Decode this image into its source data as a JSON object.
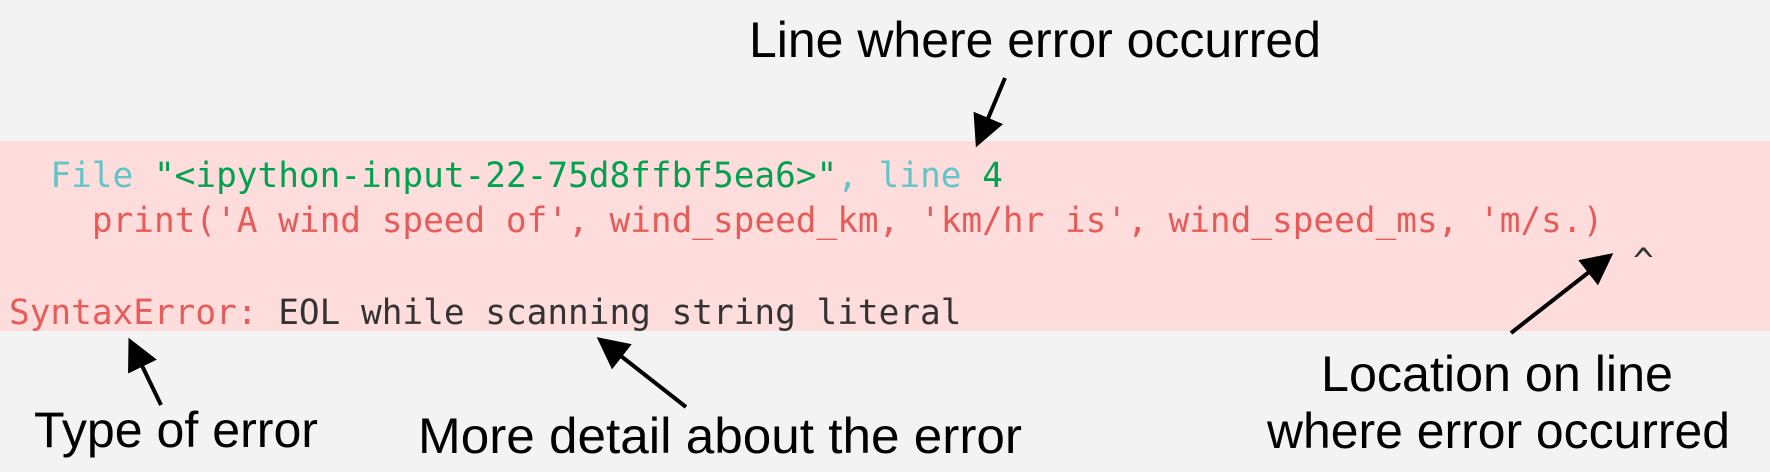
{
  "colors": {
    "background": "#f3f3f3",
    "error_band": "#ffdddd",
    "keyword": "#60c6c8",
    "string": "#00a250",
    "error": "#e75c58",
    "text": "#333333"
  },
  "traceback": {
    "file_keyword": "File",
    "file_name": "\"<ipython-input-22-75d8ffbf5ea6>\"",
    "comma": ",",
    "line_keyword": "line",
    "line_number": "4",
    "code_line": "print('A wind speed of', wind_speed_km, 'km/hr is', wind_speed_ms, 'm/s.)",
    "caret": "^",
    "error_type": "SyntaxError:",
    "error_message": "EOL while scanning string literal"
  },
  "annotations": {
    "line_label": "Line where error occurred",
    "type_label": "Type of error",
    "detail_label": "More detail about the error",
    "location_label_1": "Location on line",
    "location_label_2": "where error occurred"
  }
}
